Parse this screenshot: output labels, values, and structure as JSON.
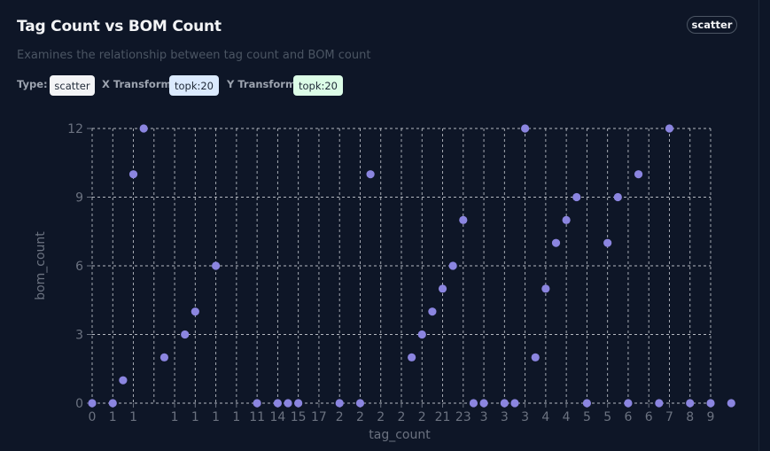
{
  "header": {
    "title": "Tag Count vs BOM Count",
    "subtitle": "Examines the relationship between tag count and BOM count",
    "chart_type_badge": "scatter"
  },
  "meta": {
    "type_label": "Type:",
    "type_value": "scatter",
    "x_transform_label": "X Transform:",
    "x_transform_value": "topk:20",
    "y_transform_label": "Y Transform:",
    "y_transform_value": "topk:20"
  },
  "colors": {
    "background": "#0e1627",
    "point": "#8b85e0",
    "grid": "#d1d5db",
    "tick_text": "#6b7280"
  },
  "chart_data": {
    "type": "scatter",
    "title": "Tag Count vs BOM Count",
    "subtitle": "Examines the relationship between tag count and BOM count",
    "xlabel": "tag_count",
    "ylabel": "bom_count",
    "ylim": [
      0,
      12
    ],
    "yticks": [
      0,
      3,
      6,
      9,
      12
    ],
    "grid": true,
    "x_categories": [
      "0",
      "1",
      "1",
      "1",
      "1",
      "1",
      "1",
      "1",
      "11",
      "14",
      "15",
      "17",
      "2",
      "2",
      "2",
      "2",
      "2",
      "21",
      "23",
      "3",
      "3",
      "3",
      "4",
      "4",
      "5",
      "5",
      "6",
      "6",
      "7",
      "8",
      "9"
    ],
    "x_tick_labels": [
      "0",
      "1",
      "1",
      "1",
      "1",
      "1",
      "1",
      "11",
      "14",
      "15",
      "17",
      "2",
      "2",
      "2",
      "2",
      "2",
      "21",
      "23",
      "3",
      "3",
      "3",
      "4",
      "4",
      "5",
      "5",
      "6",
      "6",
      "7",
      "8",
      "9"
    ],
    "points": [
      {
        "x": 0,
        "y": 0
      },
      {
        "x": 1,
        "y": 0
      },
      {
        "x": 1.5,
        "y": 1
      },
      {
        "x": 2,
        "y": 10
      },
      {
        "x": 2.5,
        "y": 12
      },
      {
        "x": 3.5,
        "y": 2
      },
      {
        "x": 4.5,
        "y": 3
      },
      {
        "x": 5,
        "y": 4
      },
      {
        "x": 6,
        "y": 6
      },
      {
        "x": 8,
        "y": 0
      },
      {
        "x": 9,
        "y": 0
      },
      {
        "x": 9.5,
        "y": 0
      },
      {
        "x": 10,
        "y": 0
      },
      {
        "x": 12,
        "y": 0
      },
      {
        "x": 13,
        "y": 0
      },
      {
        "x": 13.5,
        "y": 10
      },
      {
        "x": 15.5,
        "y": 2
      },
      {
        "x": 16,
        "y": 3
      },
      {
        "x": 16.5,
        "y": 4
      },
      {
        "x": 17,
        "y": 5
      },
      {
        "x": 17.5,
        "y": 6
      },
      {
        "x": 18,
        "y": 8
      },
      {
        "x": 18.5,
        "y": 0
      },
      {
        "x": 19,
        "y": 0
      },
      {
        "x": 20,
        "y": 0
      },
      {
        "x": 20.5,
        "y": 0
      },
      {
        "x": 21,
        "y": 12
      },
      {
        "x": 21.5,
        "y": 2
      },
      {
        "x": 22,
        "y": 5
      },
      {
        "x": 22.5,
        "y": 7
      },
      {
        "x": 23,
        "y": 8
      },
      {
        "x": 23.5,
        "y": 9
      },
      {
        "x": 24,
        "y": 0
      },
      {
        "x": 25,
        "y": 7
      },
      {
        "x": 25.5,
        "y": 9
      },
      {
        "x": 26,
        "y": 0
      },
      {
        "x": 26.5,
        "y": 10
      },
      {
        "x": 27.5,
        "y": 0
      },
      {
        "x": 28,
        "y": 12
      },
      {
        "x": 29,
        "y": 0
      },
      {
        "x": 30,
        "y": 0
      },
      {
        "x": 31,
        "y": 0
      }
    ]
  }
}
